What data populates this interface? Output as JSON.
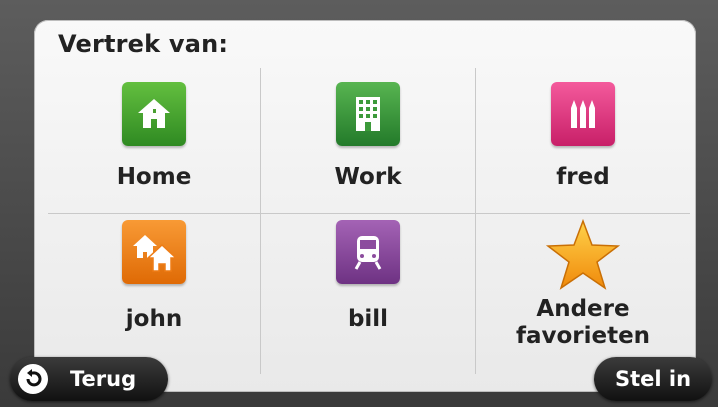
{
  "title": "Vertrek van:",
  "favorites": [
    {
      "label": "Home",
      "icon": "home-icon",
      "color": "#4aa031"
    },
    {
      "label": "Work",
      "icon": "building-icon",
      "color": "#3c9a3a"
    },
    {
      "label": "fred",
      "icon": "pencils-icon",
      "color": "#e0377f"
    },
    {
      "label": "john",
      "icon": "houses-icon",
      "color": "#ee7d16"
    },
    {
      "label": "bill",
      "icon": "train-icon",
      "color": "#8c4c9e"
    },
    {
      "label_line1": "Andere",
      "label_line2": "favorieten",
      "icon": "star-icon",
      "color": "#f6a21a"
    }
  ],
  "buttons": {
    "back": "Terug",
    "set": "Stel in"
  }
}
